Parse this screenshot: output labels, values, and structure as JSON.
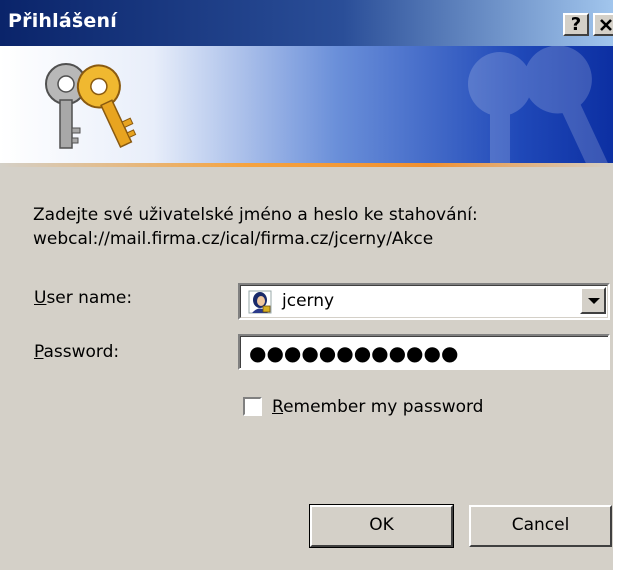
{
  "window": {
    "title": "Přihlášení",
    "help_label": "?",
    "close_label": "×"
  },
  "prompt": {
    "line1": "Zadejte své uživatelské jméno a heslo ke stahování:",
    "line2": "webcal://mail.firma.cz/ical/firma.cz/jcerny/Akce"
  },
  "form": {
    "username_label_first": "U",
    "username_label_rest": "ser name:",
    "username_value": "jcerny",
    "password_label_first": "P",
    "password_label_rest": "assword:",
    "password_value": "●●●●●●●●●●●●",
    "remember_label_first": "R",
    "remember_label_rest": "emember my password",
    "remember_checked": false
  },
  "buttons": {
    "ok": "OK",
    "cancel": "Cancel"
  },
  "colors": {
    "titlebar_start": "#0a246a",
    "titlebar_end": "#a6caf0",
    "dialog_face": "#d4d0c8",
    "banner_accent": "#f5a340"
  },
  "icons": {
    "banner": "keys-icon",
    "user": "user-avatar-icon",
    "dropdown": "chevron-down-icon"
  }
}
